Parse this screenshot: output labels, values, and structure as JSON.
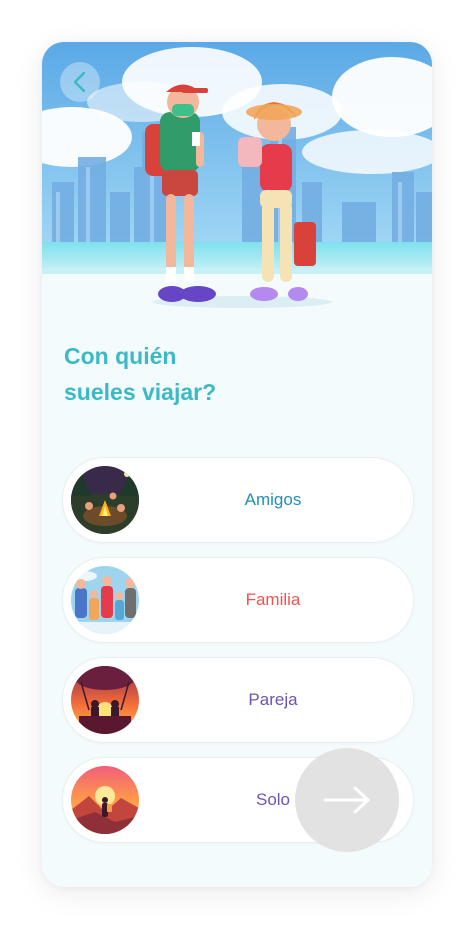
{
  "header": {
    "back_icon": "chevron-left-icon"
  },
  "question": {
    "line1": "Con quién",
    "line2": "sueles viajar?"
  },
  "options": [
    {
      "label": "Amigos",
      "color": "#1f8fb9",
      "icon": "campfire-friends-image"
    },
    {
      "label": "Familia",
      "color": "#ef5350",
      "icon": "family-image"
    },
    {
      "label": "Pareja",
      "color": "#6e54b5",
      "icon": "couple-balloon-image"
    },
    {
      "label": "Solo",
      "color": "#6e54b5",
      "icon": "solo-traveler-image"
    }
  ],
  "next_button": {
    "icon": "arrow-right-icon"
  },
  "colors": {
    "accent": "#3bbac6",
    "background": "#f4fbfd",
    "sky": "#6bb5ea",
    "button_gray": "#e2e2e2"
  }
}
